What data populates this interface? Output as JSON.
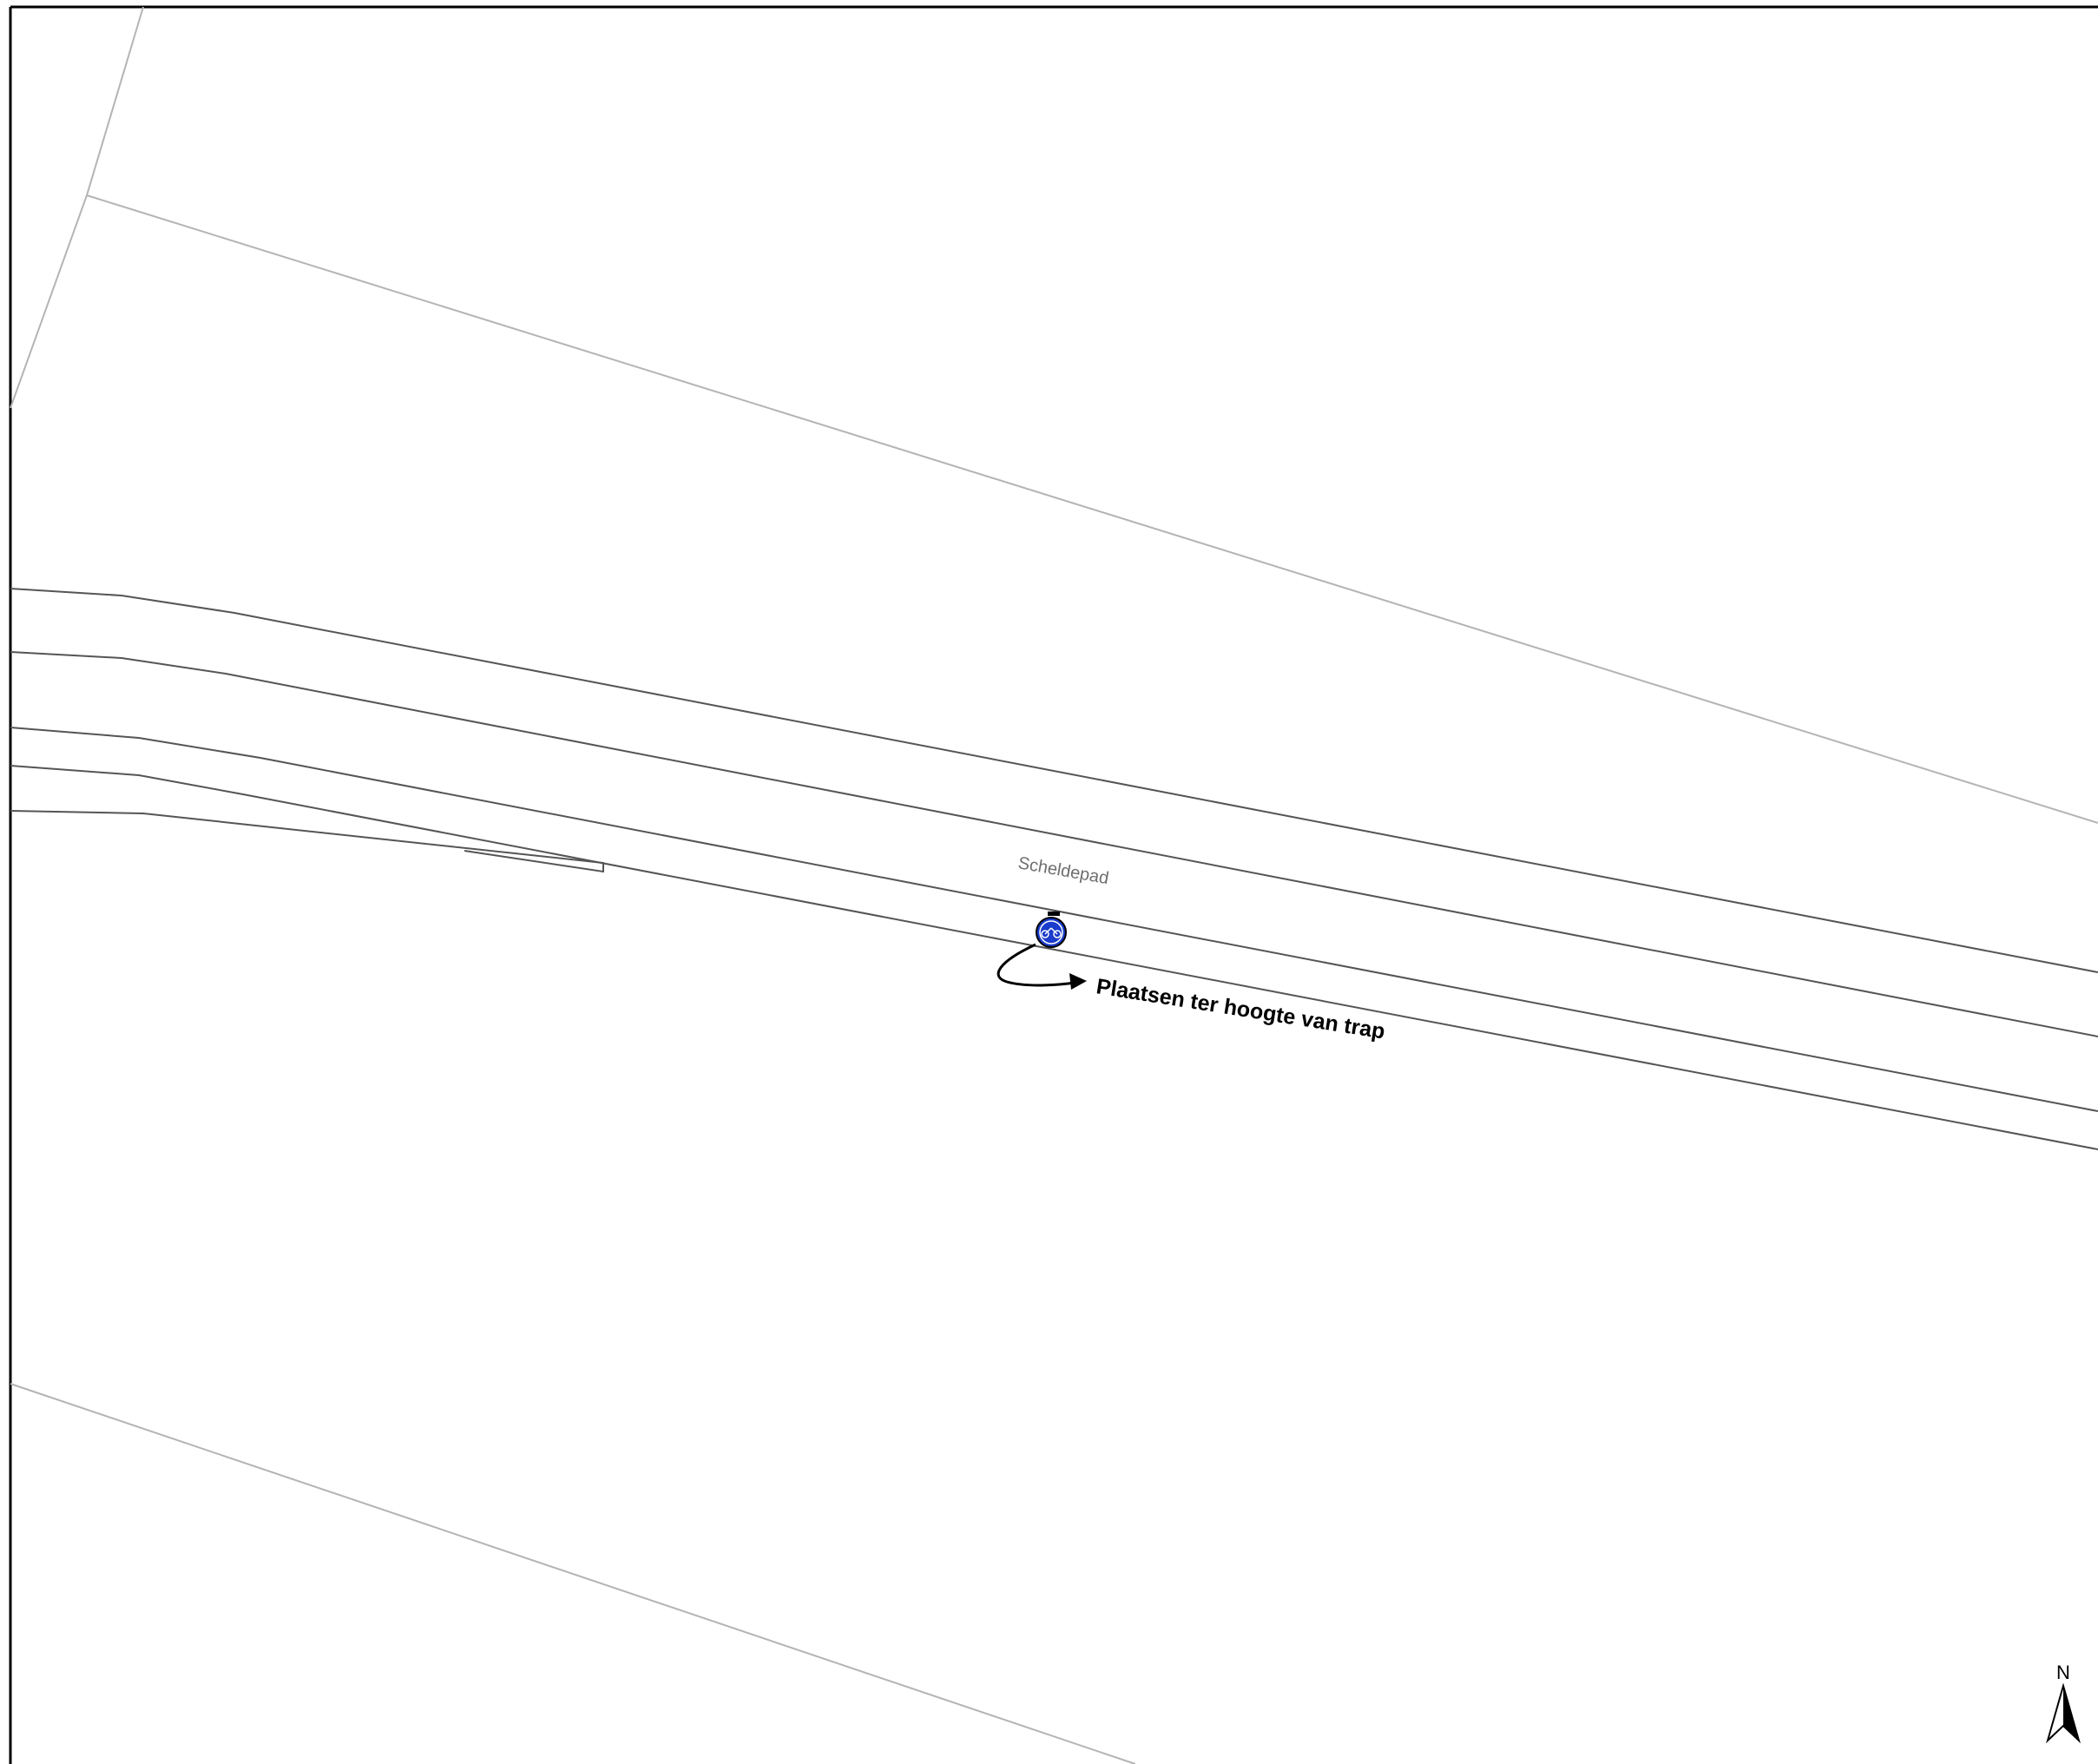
{
  "map": {
    "street_name": "Scheldepad",
    "annotation": "Plaatsen ter hoogte van trap",
    "north_label": "N",
    "sign": {
      "icon": "bicycle-moped-sign-icon",
      "color": "#1a3ccc"
    },
    "colors": {
      "frame": "#000000",
      "road_edge": "#555555",
      "parcel_line": "#b4b4b4",
      "street_label": "#6e6e6e"
    }
  }
}
